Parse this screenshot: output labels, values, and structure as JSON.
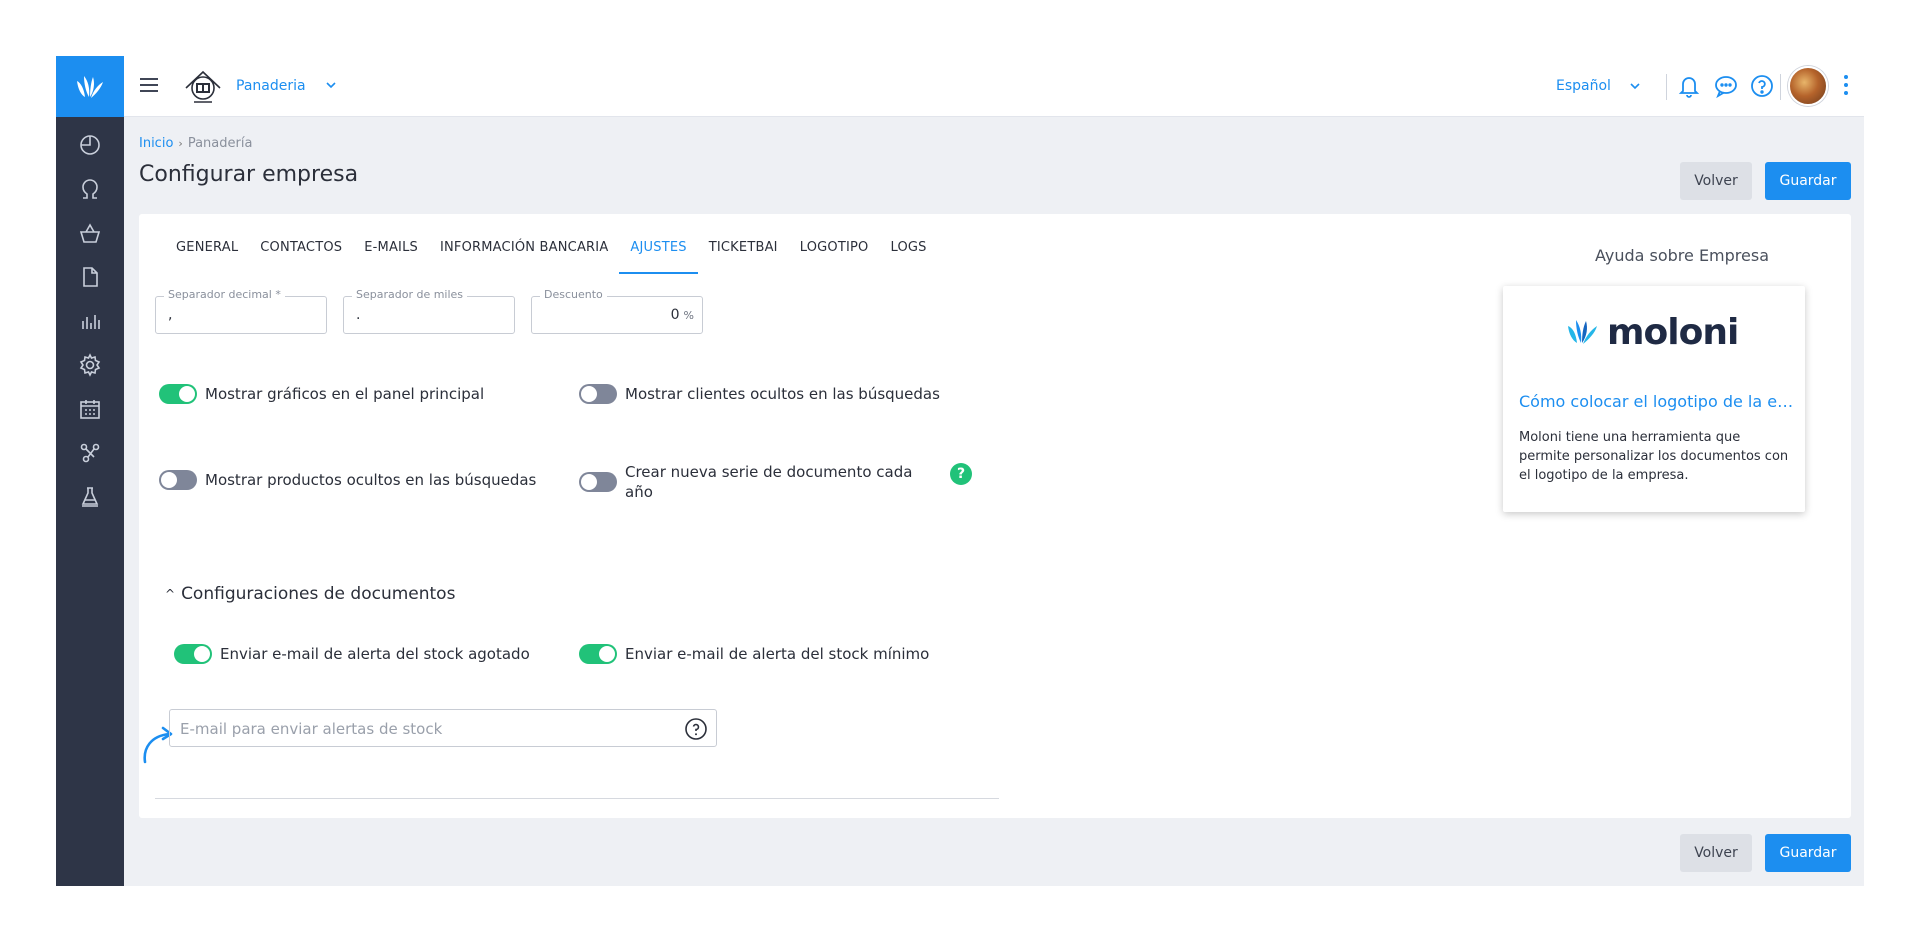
{
  "topbar": {
    "company_name": "Panaderia",
    "language": "Español"
  },
  "breadcrumb": {
    "home": "Inicio",
    "separator": "›",
    "current": "Panadería"
  },
  "page": {
    "title": "Configurar empresa",
    "back_label": "Volver",
    "save_label": "Guardar"
  },
  "tabs": [
    {
      "label": "GENERAL"
    },
    {
      "label": "CONTACTOS"
    },
    {
      "label": "E-MAILS"
    },
    {
      "label": "INFORMACIÓN BANCARIA"
    },
    {
      "label": "AJUSTES"
    },
    {
      "label": "TICKETBAI"
    },
    {
      "label": "LOGOTIPO"
    },
    {
      "label": "LOGS"
    }
  ],
  "active_tab": "AJUSTES",
  "fields": {
    "decimal": {
      "label": "Separador decimal *",
      "value": ","
    },
    "thousands": {
      "label": "Separador de miles",
      "value": "."
    },
    "discount": {
      "label": "Descuento",
      "value": "0",
      "unit": "%"
    }
  },
  "toggles": {
    "graphs": {
      "label": "Mostrar gráficos en el panel principal",
      "on": true
    },
    "hidden_clients": {
      "label": "Mostrar clientes ocultos en las búsquedas",
      "on": false
    },
    "hidden_products": {
      "label": "Mostrar productos ocultos en las búsquedas",
      "on": false
    },
    "new_series": {
      "label": "Crear nueva serie de documento cada año",
      "on": false
    },
    "stock_out": {
      "label": "Enviar e-mail de alerta del stock agotado",
      "on": true
    },
    "stock_min": {
      "label": "Enviar e-mail de alerta del stock mínimo",
      "on": true
    }
  },
  "help_badge": "?",
  "section": {
    "caret": "^",
    "title": "Configuraciones de documentos"
  },
  "stock_email": {
    "placeholder": "E-mail para enviar alertas de stock"
  },
  "help_panel": {
    "title": "Ayuda sobre Empresa",
    "logo_text": "moloni",
    "link": "Cómo colocar el logotipo de la empresa en los documentos",
    "text": "Moloni tiene una herramienta que permite personalizar los documentos con el logotipo de la empresa."
  },
  "colors": {
    "accent": "#1c8ef0",
    "sidebar": "#2e3547",
    "toggle_on": "#21c279",
    "toggle_off": "#7f8699"
  },
  "icons": {
    "sidebar": [
      "dashboard-icon",
      "customers-icon",
      "basket-icon",
      "document-icon",
      "reports-icon",
      "settings-icon",
      "calendar-icon",
      "integrations-icon",
      "lab-icon"
    ],
    "topbar": [
      "menu-icon",
      "chevron-down-icon",
      "bell-icon",
      "chat-icon",
      "help-icon",
      "kebab-icon"
    ]
  }
}
